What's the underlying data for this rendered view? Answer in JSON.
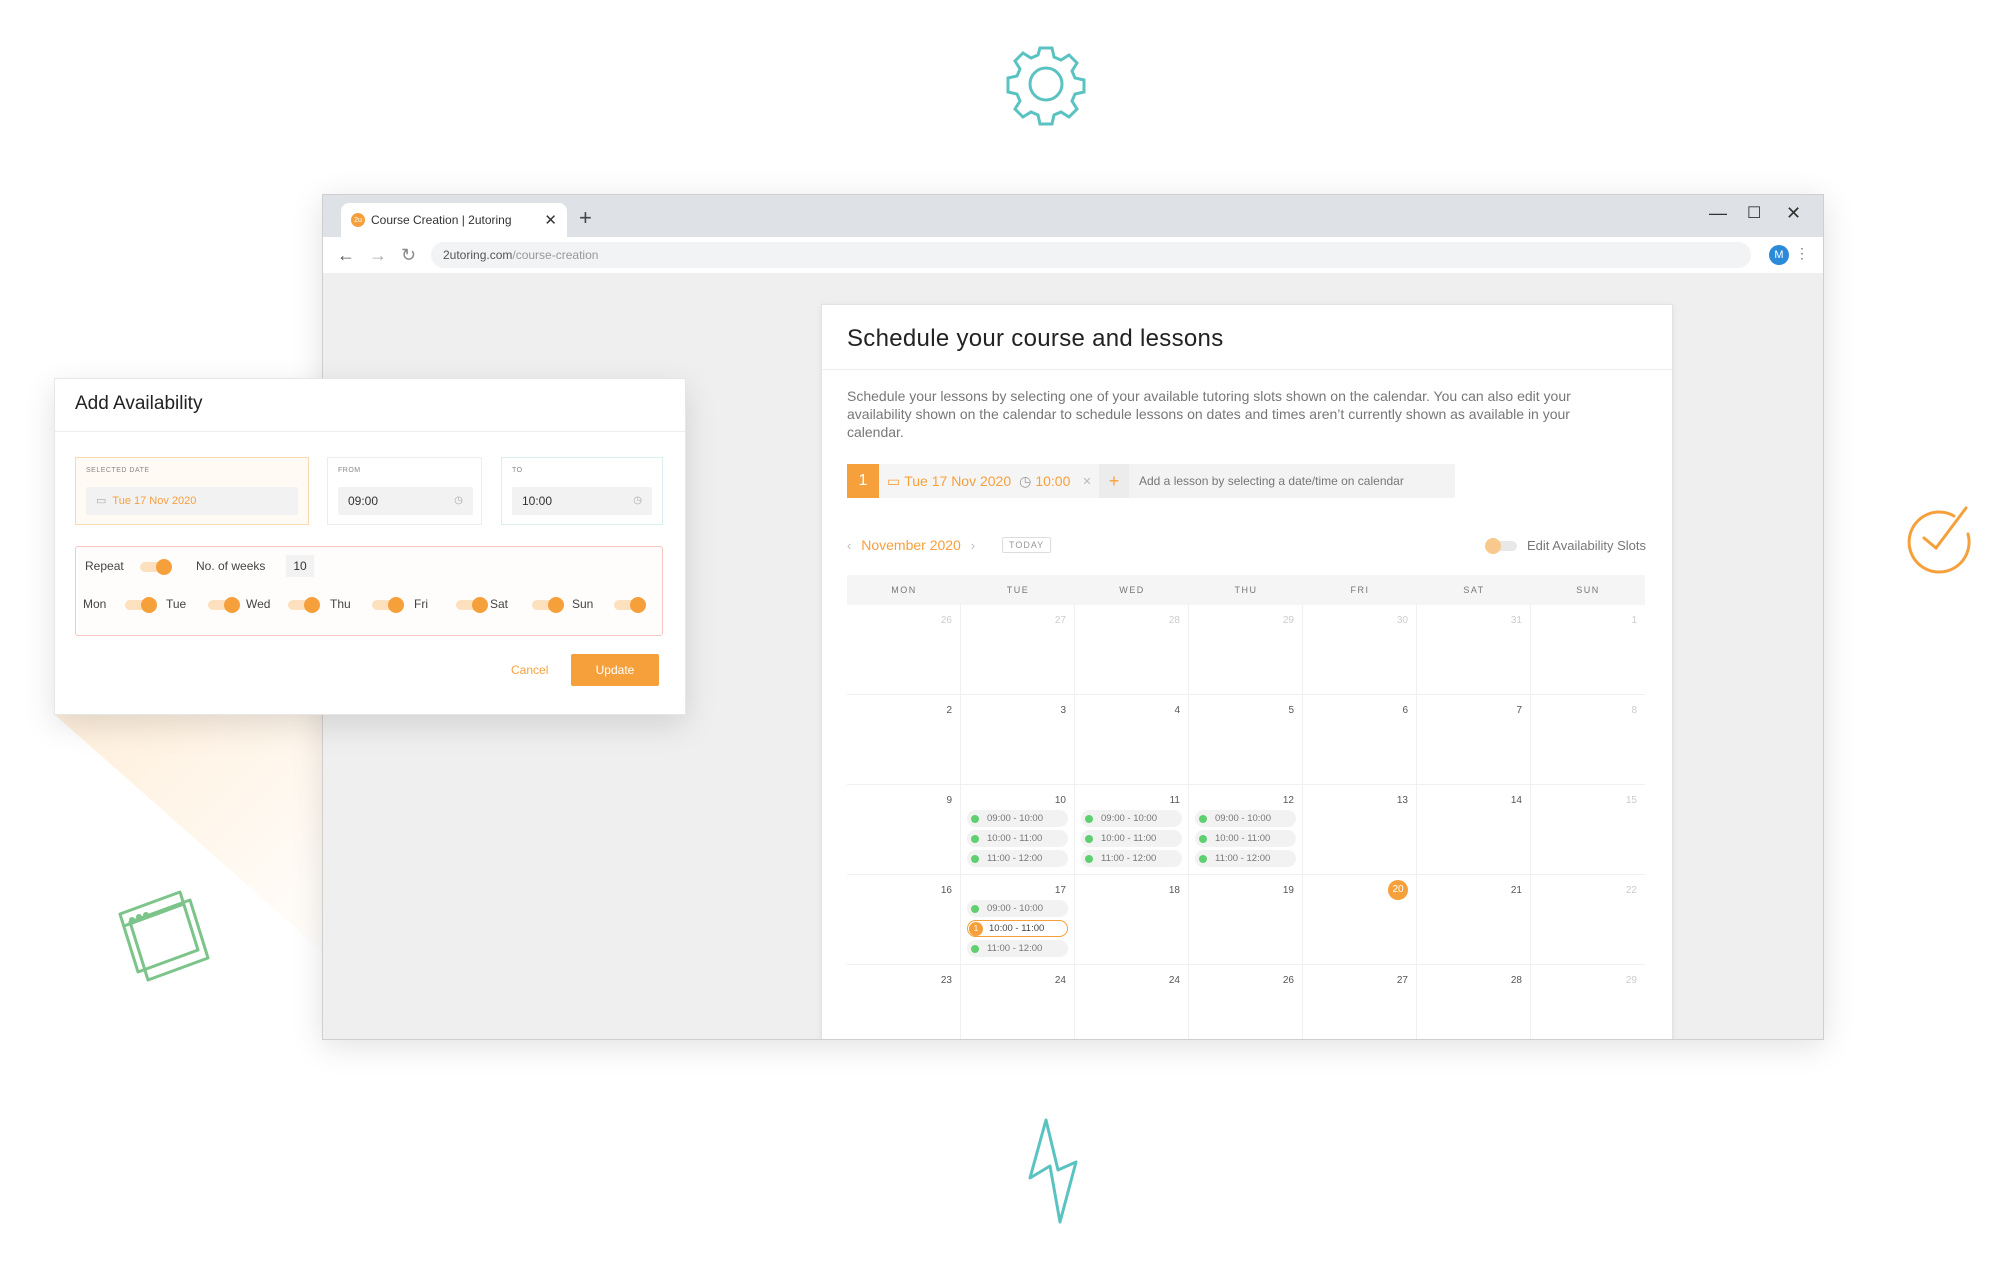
{
  "browser": {
    "tab_title": "Course Creation | 2utoring",
    "favicon_text": "2u",
    "url_domain": "2utoring.com",
    "url_path": "/course-creation",
    "profile_initial": "M"
  },
  "schedule": {
    "title": "Schedule your course and lessons",
    "description": "Schedule your lessons by selecting one of your available tutoring slots shown on the calendar. You can also edit your availability shown on the calendar to schedule lessons on dates and times aren’t currently shown as available in your calendar.",
    "selected_lesson": {
      "number": "1",
      "date": "Tue 17 Nov 2020",
      "time": "10:00"
    },
    "add_lesson_label": "Add a lesson by selecting a date/time on calendar",
    "month_label": "November 2020",
    "today_label": "TODAY",
    "edit_slots_label": "Edit Availability Slots"
  },
  "calendar": {
    "day_headers": [
      "MON",
      "TUE",
      "WED",
      "THU",
      "FRI",
      "SAT",
      "SUN"
    ],
    "weeks": [
      [
        "26",
        "27",
        "28",
        "29",
        "30",
        "31",
        "1"
      ],
      [
        "2",
        "3",
        "4",
        "5",
        "6",
        "7",
        "8"
      ],
      [
        "9",
        "10",
        "11",
        "12",
        "13",
        "14",
        "15"
      ],
      [
        "16",
        "17",
        "18",
        "19",
        "20",
        "21",
        "22"
      ],
      [
        "23",
        "24",
        "24",
        "26",
        "27",
        "28",
        "29"
      ]
    ],
    "slots": [
      "09:00 - 10:00",
      "10:00 - 11:00",
      "11:00 - 12:00"
    ],
    "today": "20",
    "selected_slot_number": "1"
  },
  "modal": {
    "title": "Add Availability",
    "selected_date_label": "SELECTED DATE",
    "selected_date_value": "Tue 17 Nov 2020",
    "from_label": "FROM",
    "from_value": "09:00",
    "to_label": "TO",
    "to_value": "10:00",
    "repeat_label": "Repeat",
    "weeks_label": "No. of weeks",
    "weeks_value": "10",
    "days": [
      "Mon",
      "Tue",
      "Wed",
      "Thu",
      "Fri",
      "Sat",
      "Sun"
    ],
    "cancel_label": "Cancel",
    "update_label": "Update"
  },
  "colors": {
    "accent": "#f6a03c",
    "available": "#5ed070",
    "teal_icon": "#5bc2c2",
    "green_icon": "#7cc48a"
  }
}
